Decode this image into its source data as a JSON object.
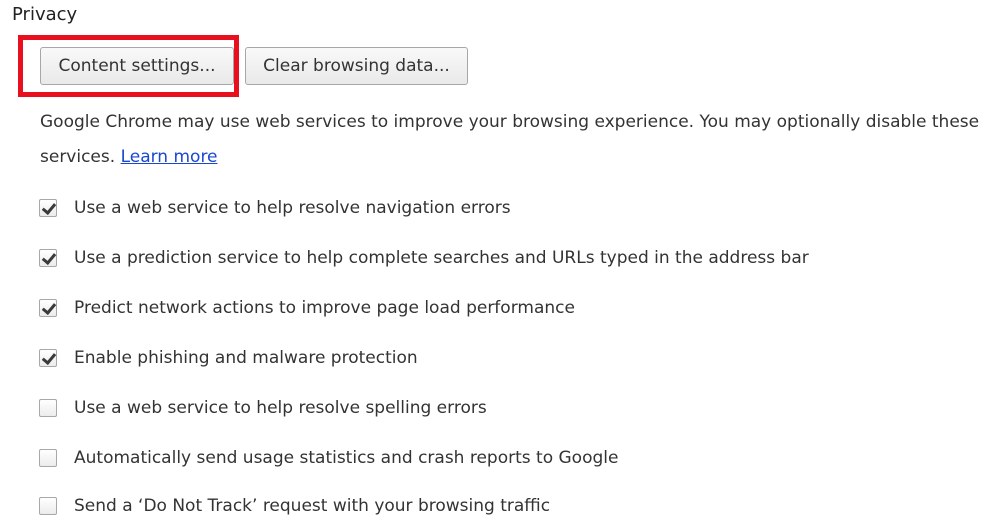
{
  "section": {
    "title": "Privacy"
  },
  "buttons": {
    "content_settings": "Content settings...",
    "clear_browsing_data": "Clear browsing data..."
  },
  "description": {
    "line1": "Google Chrome may use web services to improve your browsing experience. You may optionally disable these",
    "line2_prefix": "services.",
    "learn_more": "Learn more"
  },
  "options": [
    {
      "label": "Use a web service to help resolve navigation errors",
      "checked": true
    },
    {
      "label": "Use a prediction service to help complete searches and URLs typed in the address bar",
      "checked": true
    },
    {
      "label": "Predict network actions to improve page load performance",
      "checked": true
    },
    {
      "label": "Enable phishing and malware protection",
      "checked": true
    },
    {
      "label": "Use a web service to help resolve spelling errors",
      "checked": false
    },
    {
      "label": "Automatically send usage statistics and crash reports to Google",
      "checked": false
    },
    {
      "label": "Send a ‘Do Not Track’ request with your browsing traffic",
      "checked": false
    }
  ],
  "colors": {
    "highlight": "#e8101e",
    "link": "#1a47cf"
  }
}
